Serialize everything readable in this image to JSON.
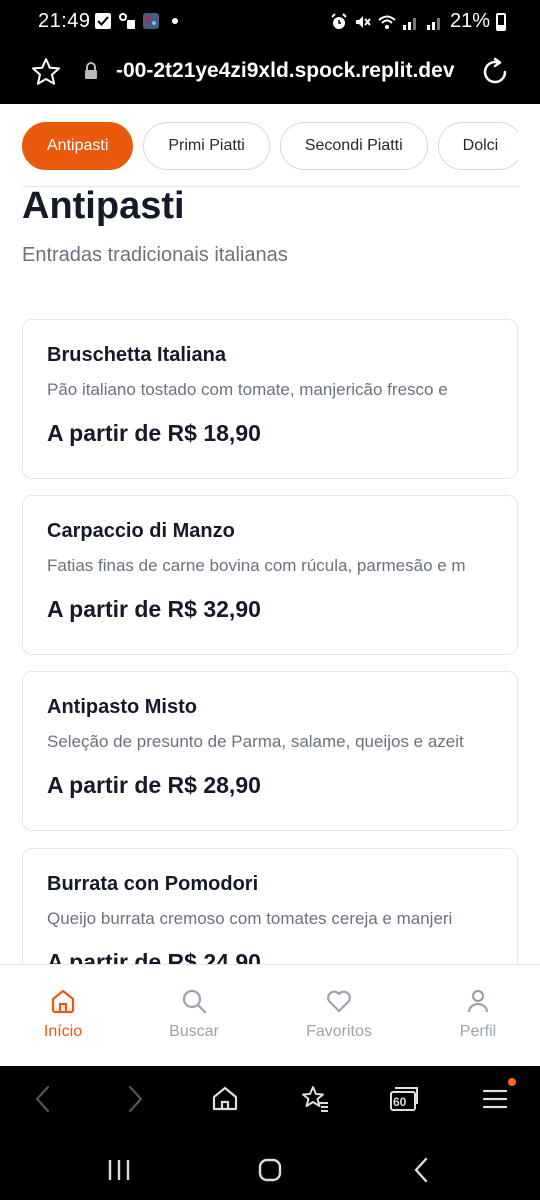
{
  "status_bar": {
    "time": "21:49",
    "battery": "21%"
  },
  "browser": {
    "url": "-00-2t21ye4zi9xld.spock.replit.dev",
    "tab_count": "60"
  },
  "tabs": [
    {
      "label": "Antipasti",
      "active": true
    },
    {
      "label": "Primi Piatti",
      "active": false
    },
    {
      "label": "Secondi Piatti",
      "active": false
    },
    {
      "label": "Dolci",
      "active": false
    }
  ],
  "section": {
    "title": "Antipasti",
    "subtitle": "Entradas tradicionais italianas"
  },
  "dishes": [
    {
      "name": "Bruschetta Italiana",
      "description": "Pão italiano tostado com tomate, manjericão fresco e",
      "price": "A partir de R$ 18,90"
    },
    {
      "name": "Carpaccio di Manzo",
      "description": "Fatias finas de carne bovina com rúcula, parmesão e m",
      "price": "A partir de R$ 32,90"
    },
    {
      "name": "Antipasto Misto",
      "description": "Seleção de presunto de Parma, salame, queijos e azeit",
      "price": "A partir de R$ 28,90"
    },
    {
      "name": "Burrata con Pomodori",
      "description": "Queijo burrata cremoso com tomates cereja e manjeri",
      "price": "A partir de R$ 24,90"
    }
  ],
  "bottom_nav": [
    {
      "label": "Início",
      "icon": "home-icon",
      "active": true
    },
    {
      "label": "Buscar",
      "icon": "search-icon",
      "active": false
    },
    {
      "label": "Favoritos",
      "icon": "heart-icon",
      "active": false
    },
    {
      "label": "Perfil",
      "icon": "user-icon",
      "active": false
    }
  ],
  "colors": {
    "accent": "#ea5a0c",
    "text_primary": "#141a27",
    "text_secondary": "#6b7280",
    "nav_inactive": "#9ca3af"
  }
}
